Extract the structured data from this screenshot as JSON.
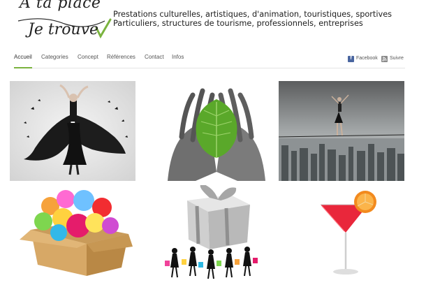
{
  "header": {
    "logo_line1": "A ta place",
    "logo_line2": "Je trouve",
    "tagline_line1": "Prestations culturelles, artistiques, d'animation, touristiques, sportives",
    "tagline_line2": "Particuliers, structures de tourisme, professionnels, entreprises"
  },
  "nav": {
    "items": [
      {
        "label": "Accueil",
        "active": true
      },
      {
        "label": "Categories"
      },
      {
        "label": "Concept"
      },
      {
        "label": "Références"
      },
      {
        "label": "Contact"
      },
      {
        "label": "Infos"
      }
    ],
    "social": [
      {
        "label": "Facebook",
        "icon": "facebook-icon"
      },
      {
        "label": "Suivre",
        "icon": "rss-icon"
      }
    ]
  },
  "colors": {
    "accent": "#7ab33e",
    "facebook": "#4a66a0",
    "rss": "#8a8a8a"
  },
  "tiles": [
    {
      "name": "dancer-photo"
    },
    {
      "name": "leaf-hands-photo"
    },
    {
      "name": "tightrope-city-photo"
    },
    {
      "name": "balloons-box-photo"
    },
    {
      "name": "gift-shoppers-photo"
    },
    {
      "name": "cocktail-photo"
    }
  ]
}
